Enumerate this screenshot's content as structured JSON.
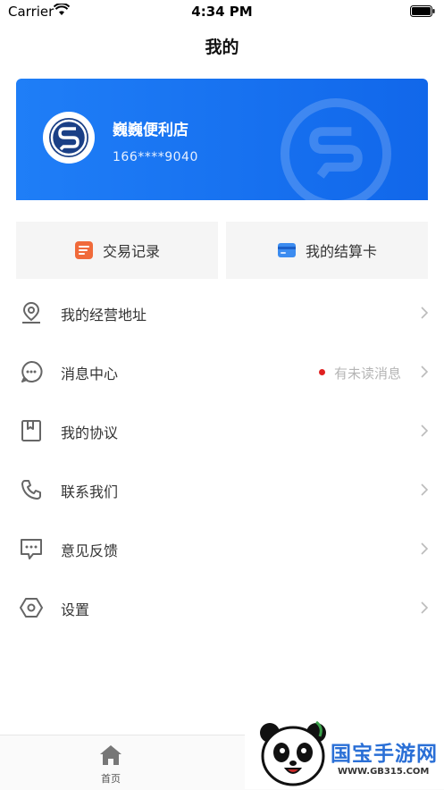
{
  "status_bar": {
    "carrier": "Carrier",
    "time": "4:34 PM"
  },
  "header": {
    "title": "我的"
  },
  "profile": {
    "store_name": "巍巍便利店",
    "phone": "166****9040"
  },
  "quick_actions": [
    {
      "label": "交易记录",
      "icon": "document-list-icon"
    },
    {
      "label": "我的结算卡",
      "icon": "bank-card-icon"
    }
  ],
  "menu": [
    {
      "label": "我的经营地址",
      "icon": "location-pin-icon"
    },
    {
      "label": "消息中心",
      "icon": "message-bubble-icon",
      "badge_text": "有未读消息"
    },
    {
      "label": "我的协议",
      "icon": "bookmark-book-icon"
    },
    {
      "label": "联系我们",
      "icon": "phone-icon"
    },
    {
      "label": "意见反馈",
      "icon": "feedback-chat-icon"
    },
    {
      "label": "设置",
      "icon": "settings-hexagon-icon"
    }
  ],
  "tab_bar": {
    "home_label": "首页"
  },
  "watermark_badge": {
    "title": "国宝手游网",
    "url": "WWW.GB315.COM"
  },
  "colors": {
    "brand_blue": "#1677f0",
    "unread_red": "#e02020",
    "badge_blue": "#2a6fd6"
  }
}
